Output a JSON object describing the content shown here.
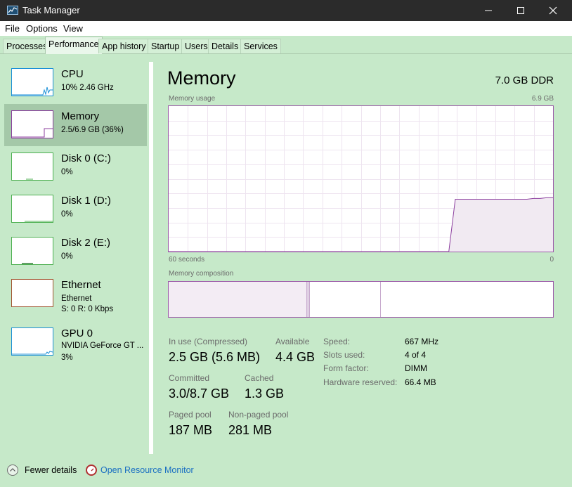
{
  "window": {
    "title": "Task Manager",
    "controls": {
      "minimize": "—",
      "maximize": "☐",
      "close": "✕"
    }
  },
  "menu": [
    "File",
    "Options",
    "View"
  ],
  "tabs": [
    "Processes",
    "Performance",
    "App history",
    "Startup",
    "Users",
    "Details",
    "Services"
  ],
  "active_tab": "Performance",
  "sidebar": [
    {
      "name": "CPU",
      "sub": "10% 2.46 GHz",
      "sub2": "",
      "color": "#1a8fd6"
    },
    {
      "name": "Memory",
      "sub": "2.5/6.9 GB (36%)",
      "sub2": "",
      "color": "#8b3d9e",
      "selected": true
    },
    {
      "name": "Disk 0 (C:)",
      "sub": "0%",
      "sub2": "",
      "color": "#4caf50"
    },
    {
      "name": "Disk 1 (D:)",
      "sub": "0%",
      "sub2": "",
      "color": "#4caf50"
    },
    {
      "name": "Disk 2 (E:)",
      "sub": "0%",
      "sub2": "",
      "color": "#4caf50"
    },
    {
      "name": "Ethernet",
      "sub": "Ethernet",
      "sub2": "S: 0 R: 0 Kbps",
      "color": "#a0522d"
    },
    {
      "name": "GPU 0",
      "sub": "NVIDIA GeForce GT ...",
      "sub2": "3%",
      "color": "#1a8fd6"
    }
  ],
  "main": {
    "title": "Memory",
    "spec": "7.0 GB DDR",
    "usage_label": "Memory usage",
    "usage_max": "6.9 GB",
    "time_left": "60 seconds",
    "time_right": "0",
    "composition_label": "Memory composition",
    "usage_history_fraction": [
      0,
      0,
      0,
      0,
      0,
      0,
      0,
      0,
      0,
      0,
      0,
      0,
      0,
      0,
      0,
      0,
      0,
      0,
      0,
      0,
      0,
      0,
      0,
      0,
      0,
      0,
      0,
      0,
      0,
      0,
      0,
      0,
      0,
      0,
      0,
      0,
      0,
      0,
      0,
      0,
      0,
      0,
      0,
      0,
      0.36,
      0.36,
      0.36,
      0.36,
      0.36,
      0.36,
      0.36,
      0.36,
      0.36,
      0.36,
      0.36,
      0.36,
      0.365,
      0.365,
      0.37,
      0.37
    ]
  },
  "stats": {
    "in_use_label": "In use (Compressed)",
    "in_use_value": "2.5 GB (5.6 MB)",
    "available_label": "Available",
    "available_value": "4.4 GB",
    "committed_label": "Committed",
    "committed_value": "3.0/8.7 GB",
    "cached_label": "Cached",
    "cached_value": "1.3 GB",
    "paged_label": "Paged pool",
    "paged_value": "187 MB",
    "nonpaged_label": "Non-paged pool",
    "nonpaged_value": "281 MB"
  },
  "details": [
    {
      "label": "Speed:",
      "value": "667 MHz"
    },
    {
      "label": "Slots used:",
      "value": "4 of 4"
    },
    {
      "label": "Form factor:",
      "value": "DIMM"
    },
    {
      "label": "Hardware reserved:",
      "value": "66.4 MB"
    }
  ],
  "footer": {
    "fewer_details": "Fewer details",
    "open_monitor": "Open Resource Monitor"
  },
  "colors": {
    "background": "#c6e9c9",
    "memory_accent": "#8b3d9e",
    "link": "#1a6fc2"
  }
}
